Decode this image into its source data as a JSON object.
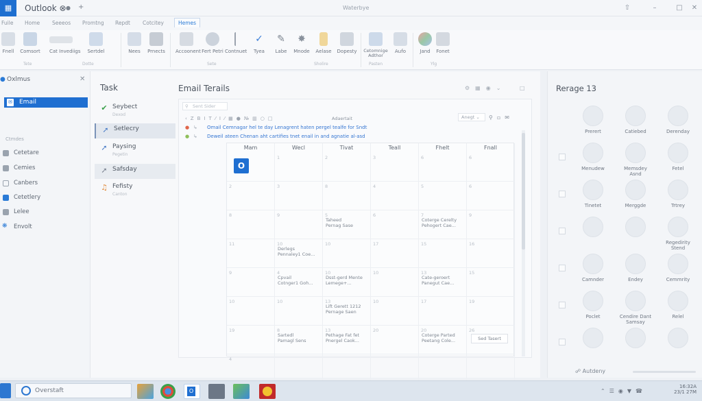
{
  "window": {
    "title": "Outlook ⊗",
    "title_center": "Waterbye",
    "app_icon": "outlook-app-icon",
    "title_icons": [
      "pin-icon",
      "plus-icon"
    ],
    "controls": [
      "ribbon-display-icon",
      "minimize-icon",
      "restore-icon",
      "close-icon"
    ]
  },
  "ribbon": {
    "tabs": [
      "Fuile",
      "Home",
      "Seeeos",
      "Promtng",
      "Repdt",
      "Cotcitey",
      "Hemes"
    ],
    "active_tab": "Hemes",
    "buttons": [
      {
        "label": "Fnell",
        "icon": "new-icon"
      },
      {
        "label": "Comsort",
        "icon": "grid-icon"
      },
      {
        "label": "Cat Invediigs",
        "icon": "list-icon"
      },
      {
        "label": "Sertdel",
        "icon": "doc-icon"
      },
      {
        "label": "Nees",
        "icon": "page-icon"
      },
      {
        "label": "Prnects",
        "icon": "printer-icon"
      },
      {
        "label": "Accoonent",
        "icon": "table-icon"
      },
      {
        "label": "Fert Petri",
        "icon": "settings-icon"
      },
      {
        "label": "Contnuet",
        "icon": "bracket-icon"
      },
      {
        "label": "Tyea",
        "icon": "check-icon"
      },
      {
        "label": "Labe",
        "icon": "pencil-icon"
      },
      {
        "label": "Mnode",
        "icon": "sparkle-icon"
      },
      {
        "label": "Aelase",
        "icon": "bookmark-icon"
      },
      {
        "label": "Dopesty",
        "icon": "people-icon"
      },
      {
        "label": "Cetomnige Adthor",
        "icon": "badge-icon"
      },
      {
        "label": "Aufo",
        "icon": "screen-icon"
      },
      {
        "label": "Jand",
        "icon": "colors-icon"
      },
      {
        "label": "Fonet",
        "icon": "stamp-icon"
      }
    ],
    "groups": [
      "Tete",
      "Dotte",
      "Sete",
      "Sholire",
      "Pasten",
      "Ylg"
    ]
  },
  "left_panel": {
    "header": "Oxlmus",
    "selected": "Email",
    "section": "Ctmdes",
    "items": [
      "Cetetare",
      "Cemies",
      "Canbers",
      "Cetetlery",
      "Lelee",
      "Envolt"
    ]
  },
  "task_panel": {
    "title": "Task",
    "items": [
      {
        "label": "Seybect",
        "sub": "Dexod",
        "icon": "check-circle-icon",
        "color": "#3aa04a"
      },
      {
        "label": "Setlecry",
        "sub": "",
        "icon": "share-icon",
        "color": "#4a7cc7"
      },
      {
        "label": "Paysing",
        "sub": "Pegetin",
        "icon": "share-icon",
        "color": "#4a7cc7"
      },
      {
        "label": "Safsday",
        "sub": "",
        "icon": "share-icon",
        "color": "#7a8290"
      },
      {
        "label": "Fefisty",
        "sub": "Canton",
        "icon": "music-icon",
        "color": "#e08a3a"
      }
    ]
  },
  "main": {
    "title": "Email Terails",
    "search_placeholder": "Sent Sider",
    "format_label": "Adaertait",
    "dropdown": "Anegt",
    "messages": [
      "Omail Cemnagar hel te day Lenagrent haten pergel tealfe for Sndt",
      "Deweil ateen Chenan aht cartifies tnet enail in and agnatie al-asd"
    ],
    "calendar": {
      "days": [
        "Mam",
        "Wecl",
        "Tivat",
        "Teall",
        "Fhelt",
        "Fnall"
      ],
      "rows": [
        [
          "",
          "1",
          "2",
          "3",
          "6",
          "6"
        ],
        [
          "2",
          "3",
          "8",
          "4",
          "5",
          "6"
        ],
        [
          "8",
          "9",
          "5",
          "6",
          "7",
          "9"
        ],
        [
          "11",
          "10",
          "10",
          "17",
          "15",
          "16"
        ],
        [
          "9",
          "4",
          "10",
          "10",
          "13",
          "15"
        ],
        [
          "10",
          "10",
          "13",
          "10",
          "17",
          "19"
        ],
        [
          "19",
          "8",
          "13",
          "20",
          "20",
          "26"
        ],
        [
          "4",
          "",
          "",
          "",
          "",
          ""
        ]
      ],
      "events": [
        {
          "row": 2,
          "col": 2,
          "text": "Taheed\nPernag Sase"
        },
        {
          "row": 2,
          "col": 4,
          "text": "Coterge Cerelty\nPehogert Cae..."
        },
        {
          "row": 3,
          "col": 1,
          "text": "Derlegs\nPennaley1 Coe..."
        },
        {
          "row": 4,
          "col": 1,
          "text": "Cpvail\nCotnger1 Goh..."
        },
        {
          "row": 4,
          "col": 2,
          "text": "Dsst-gerd Mente\nLemege+..."
        },
        {
          "row": 4,
          "col": 4,
          "text": "Cate-geroert\nPanegut Cae..."
        },
        {
          "row": 5,
          "col": 2,
          "text": "Lift Gerett 1212\nPernage Saen"
        },
        {
          "row": 6,
          "col": 1,
          "text": "Sartedl\nPamagl Sens"
        },
        {
          "row": 6,
          "col": 2,
          "text": "Pethage Fat fet\nPnergel Caok..."
        },
        {
          "row": 6,
          "col": 4,
          "text": "Coterge Parted\nPeetang Cole..."
        }
      ],
      "send_button": "Sed Tasert"
    }
  },
  "right_panel": {
    "title": "Rerage 13",
    "tiles": [
      [
        "Prerert",
        "Catiebed",
        "Derenday"
      ],
      [
        "Menudew",
        "Memsdey\nAsnd",
        "Fetel"
      ],
      [
        "Tinetet",
        "Merggde",
        "Trtrey"
      ],
      [
        "",
        "",
        "Regedirity\nStend"
      ],
      [
        "Camnder",
        "Endey",
        "Cemmrity"
      ],
      [
        "Poclet",
        "Cendire Dant\nSamsay",
        "Relel"
      ],
      [
        "",
        "",
        ""
      ]
    ],
    "footer": "Autdeny"
  },
  "taskbar": {
    "search": "Overstaft",
    "apps": [
      "file-explorer-icon",
      "chrome-icon",
      "outlook-icon",
      "folder-icon",
      "maps-icon",
      "pdf-icon"
    ],
    "time": "16:32A",
    "date": "23/1 27M"
  }
}
